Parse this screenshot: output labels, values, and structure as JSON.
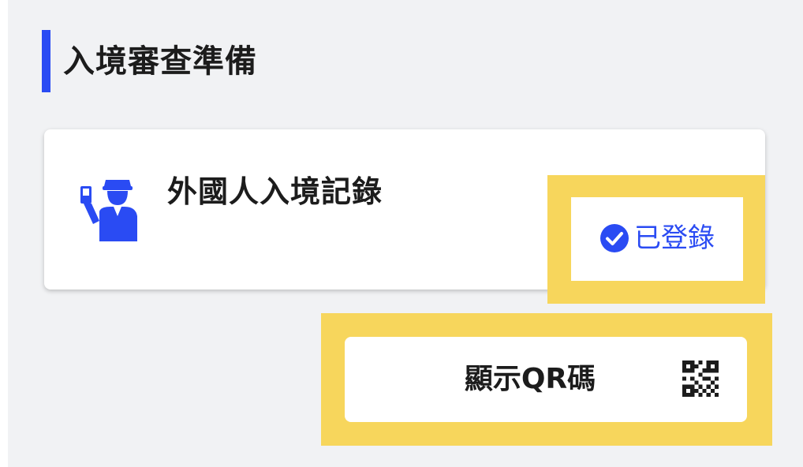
{
  "section": {
    "title": "入境審查準備"
  },
  "card": {
    "title": "外國人入境記錄",
    "status_label": "已登錄"
  },
  "qr_button": {
    "label": "顯示QR碼"
  },
  "colors": {
    "accent": "#2a4bf3",
    "highlight": "#f7d65c",
    "background": "#f1f2f4",
    "text": "#1c1c1c"
  },
  "icons": {
    "officer": "immigration-officer-icon",
    "check": "check-circle-icon",
    "qr": "qr-code-icon"
  }
}
